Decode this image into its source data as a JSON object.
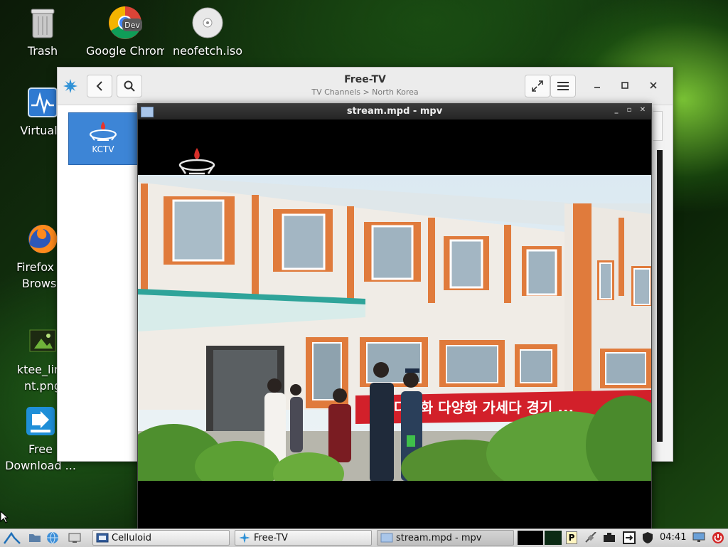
{
  "desktop": {
    "icons": [
      {
        "label": "Trash",
        "icon": "trash-icon"
      },
      {
        "label": "Google Chrome (u",
        "icon": "chrome-dev-icon",
        "badge": "Dev"
      },
      {
        "label": "neofetch.iso",
        "icon": "disc-icon"
      },
      {
        "label": "VirtualB",
        "icon": "virtualbox-icon"
      },
      {
        "label": "Firefox W",
        "label2": "Browse",
        "icon": "firefox-icon"
      },
      {
        "label": "ktee_linu",
        "label2": "nt.png",
        "icon": "image-file-icon"
      },
      {
        "label": "Free",
        "label2": "Download ...",
        "icon": "free-download-manager-icon"
      }
    ]
  },
  "freetv": {
    "title": "Free-TV",
    "subtitle": "TV Channels > North Korea",
    "channel": {
      "label": "KCTV",
      "icon": "kctv-logo-icon"
    }
  },
  "mpv": {
    "title": "stream.mpd - mpv",
    "banner_text": "다종화 다양화 가세다 경기 ..."
  },
  "taskbar": {
    "tasks": [
      {
        "label": "Celluloid",
        "icon": "celluloid-icon"
      },
      {
        "label": "Free-TV",
        "icon": "freetv-icon"
      },
      {
        "label": "stream.mpd - mpv",
        "icon": "mpv-window-icon"
      }
    ],
    "clock": "04:41",
    "tray_p": "P"
  }
}
